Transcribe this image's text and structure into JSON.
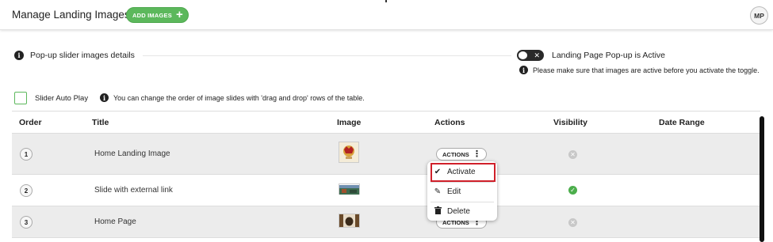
{
  "header": {
    "title": "Manage Landing Images",
    "add_button_label": "ADD IMAGES",
    "add_button_icon": "plus-icon",
    "avatar_initials": "MP"
  },
  "section": {
    "title": "Pop-up slider images details",
    "toggle_label": "Landing Page Pop-up is Active",
    "toggle_state": "off",
    "toggle_note": "Please make sure that images are active before you activate the toggle.",
    "autoplay_label": "Slider Auto Play",
    "autoplay_checked": false,
    "reorder_note": "You can change the order of image slides with 'drag and drop' rows of the table."
  },
  "table": {
    "columns": [
      "Order",
      "Title",
      "Image",
      "Actions",
      "Visibility",
      "Date Range"
    ],
    "rows": [
      {
        "order": "1",
        "title": "Home Landing Image",
        "actions_label": "ACTIONS",
        "visible": false
      },
      {
        "order": "2",
        "title": "Slide with external link",
        "actions_label": "ACTIONS",
        "visible": true
      },
      {
        "order": "3",
        "title": "Home Page",
        "actions_label": "ACTIONS",
        "visible": false
      }
    ]
  },
  "dropdown": {
    "items": [
      {
        "label": "Activate",
        "icon": "check-icon"
      },
      {
        "label": "Edit",
        "icon": "pencil-icon"
      },
      {
        "label": "Delete",
        "icon": "trash-icon"
      }
    ]
  },
  "colors": {
    "accent_green": "#5cb85c",
    "highlight_red": "#d0202a",
    "row_alt": "#ececec"
  }
}
